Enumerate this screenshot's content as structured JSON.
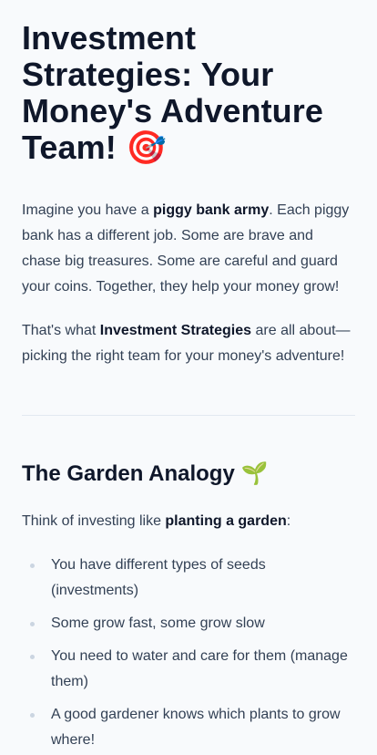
{
  "header": {
    "title": "Investment Strategies: Your Money's Adventure Team!",
    "title_emoji": "🎯"
  },
  "intro": {
    "p1_before": "Imagine you have a ",
    "p1_bold": "piggy bank army",
    "p1_after": ". Each piggy bank has a different job. Some are brave and chase big treasures. Some are careful and guard your coins. Together, they help your money grow!",
    "p2_before": "That's what ",
    "p2_bold": "Investment Strategies",
    "p2_after": " are all about—picking the right team for your money's adventure!"
  },
  "garden": {
    "heading": "The Garden Analogy",
    "heading_emoji": "🌱",
    "lead_before": "Think of investing like ",
    "lead_bold": "planting a garden",
    "lead_after": ":",
    "items": [
      "You have different types of seeds (investments)",
      "Some grow fast, some grow slow",
      "You need to water and care for them (manage them)",
      "A good gardener knows which plants to grow where!"
    ]
  }
}
